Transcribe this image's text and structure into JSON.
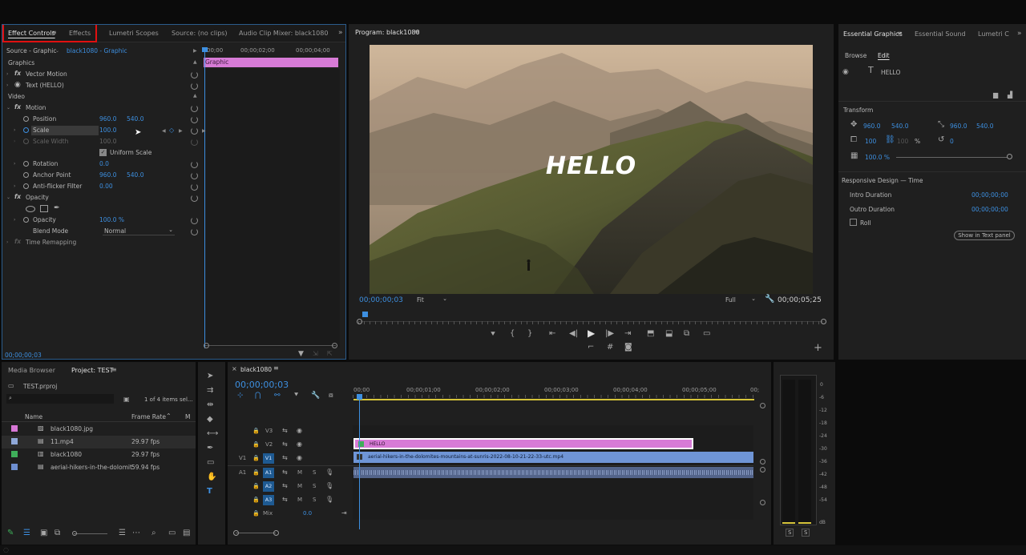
{
  "effect_controls": {
    "tabs": [
      "Effect Controls",
      "Effects",
      "Lumetri Scopes",
      "Source: (no clips)",
      "Audio Clip Mixer: black1080"
    ],
    "source_label": "Source - Graphic",
    "clip_label": "black1080 - Graphic",
    "ruler_start": "00;00",
    "ruler_mid": "00;00;02;00",
    "ruler_end": "00;00;04;00",
    "graphic_bar_label": "Graphic",
    "sections": {
      "graphics": "Graphics",
      "vector_motion": "Vector Motion",
      "text_layer": "Text (HELLO)",
      "video": "Video",
      "motion": "Motion",
      "opacity_group": "Opacity",
      "time_remap": "Time Remapping"
    },
    "props": {
      "position": {
        "label": "Position",
        "x": "960.0",
        "y": "540.0"
      },
      "scale": {
        "label": "Scale",
        "value": "100.0"
      },
      "scale_width": {
        "label": "Scale Width",
        "value": "100.0"
      },
      "uniform_scale": "Uniform Scale",
      "rotation": {
        "label": "Rotation",
        "value": "0.0"
      },
      "anchor": {
        "label": "Anchor Point",
        "x": "960.0",
        "y": "540.0"
      },
      "antiflicker": {
        "label": "Anti-flicker Filter",
        "value": "0.00"
      },
      "opacity": {
        "label": "Opacity",
        "value": "100.0 %"
      },
      "blend": {
        "label": "Blend Mode",
        "value": "Normal"
      }
    },
    "timecode": "00;00;00;03"
  },
  "program": {
    "title": "Program: black1080",
    "overlay_text": "HELLO",
    "timecode": "00;00;00;03",
    "fit": "Fit",
    "quality": "Full",
    "duration": "00;00;05;25"
  },
  "essential_graphics": {
    "tabs": [
      "Essential Graphics",
      "Essential Sound",
      "Lumetri C"
    ],
    "subtabs": [
      "Browse",
      "Edit"
    ],
    "layer": "HELLO",
    "transform_label": "Transform",
    "pos": [
      "960.0",
      "540.0"
    ],
    "anchor": [
      "960.0",
      "540.0"
    ],
    "scale": "100",
    "scale2": "100",
    "pct": "%",
    "rotation": "0",
    "opacity": "100.0 %",
    "responsive": "Responsive Design — Time",
    "intro_label": "Intro Duration",
    "intro_val": "00;00;00;00",
    "outro_label": "Outro Duration",
    "outro_val": "00;00;00;00",
    "roll": "Roll",
    "show_text_panel": "Show in Text panel"
  },
  "project": {
    "tabs": [
      "Media Browser",
      "Project: TEST"
    ],
    "file": "TEST.prproj",
    "selection": "1 of 4 items sel...",
    "col_name": "Name",
    "col_rate": "Frame Rate",
    "col_m": "M",
    "items": [
      {
        "name": "black1080.jpg",
        "rate": "",
        "color": "#d777d6"
      },
      {
        "name": "11.mp4",
        "rate": "29.97 fps",
        "color": "#8fa8d8"
      },
      {
        "name": "black1080",
        "rate": "29.97 fps",
        "color": "#3fae5a"
      },
      {
        "name": "aerial-hikers-in-the-dolomit",
        "rate": "59.94 fps",
        "color": "#6e8fd0"
      }
    ]
  },
  "timeline": {
    "tab": "black1080",
    "timecode": "00;00;00;03",
    "ruler": [
      "00;00",
      "00;00;01;00",
      "00;00;02;00",
      "00;00;03;00",
      "00;00;04;00",
      "00;00;05;00",
      "00;"
    ],
    "tracks_video": [
      "V3",
      "V2",
      "V1"
    ],
    "tracks_audio": [
      "A1",
      "A2",
      "A3"
    ],
    "src_v": "V1",
    "src_a": "A1",
    "mix_label": "Mix",
    "mix_value": "0.0",
    "clip_hello": "HELLO",
    "clip_video": "aerial-hikers-in-the-dolomites-mountains-at-sunris-2022-08-10-21-22-33-utc.mp4",
    "m": "M",
    "s": "S"
  },
  "meter": {
    "scale": [
      "0",
      "-6",
      "-12",
      "-18",
      "-24",
      "-30",
      "-36",
      "-42",
      "-48",
      "-54",
      "dB"
    ],
    "solo": [
      "S",
      "S"
    ]
  }
}
